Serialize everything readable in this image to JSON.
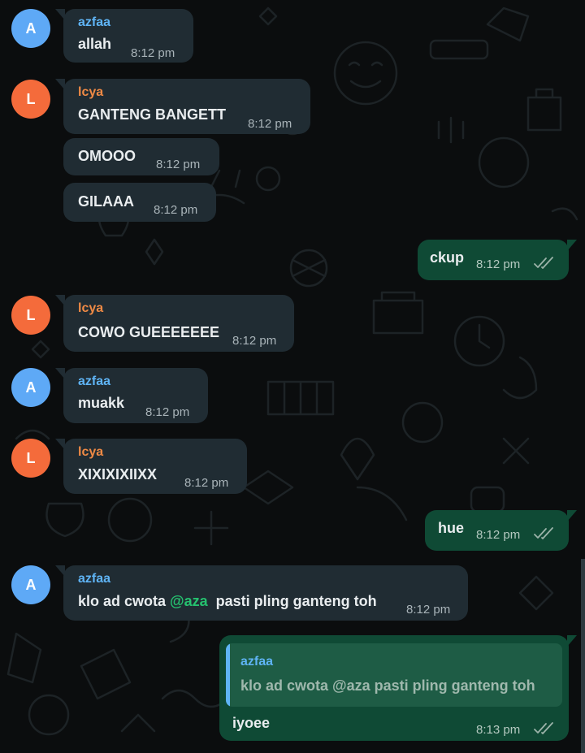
{
  "messages": [
    {
      "sender": "azfaa",
      "initial": "A",
      "text": "allah",
      "time": "8:12 pm"
    },
    {
      "sender": "lcya",
      "initial": "L",
      "text": "GANTENG BANGETT",
      "time": "8:12 pm"
    },
    {
      "text": "OMOOO",
      "time": "8:12 pm"
    },
    {
      "text": "GILAAA",
      "time": "8:12 pm"
    },
    {
      "text": "ckup",
      "time": "8:12 pm",
      "status": "read"
    },
    {
      "sender": "lcya",
      "initial": "L",
      "text": "COWO GUEEEEEEE",
      "time": "8:12 pm"
    },
    {
      "sender": "azfaa",
      "initial": "A",
      "text": "muakk",
      "time": "8:12 pm"
    },
    {
      "sender": "lcya",
      "initial": "L",
      "text": "XIXIXIXIIXX",
      "time": "8:12 pm"
    },
    {
      "text": "hue",
      "time": "8:12 pm",
      "status": "read"
    },
    {
      "sender": "azfaa",
      "initial": "A",
      "text_before": "klo ad cwota",
      "mention": "@aza",
      "text_after": "pasti pling ganteng toh",
      "time": "8:12 pm"
    },
    {
      "quote_sender": "azfaa",
      "quote_text": "klo ad cwota @aza  pasti pling ganteng toh",
      "text": "iyoee",
      "time": "8:13 pm",
      "status": "read"
    }
  ],
  "colors": {
    "background": "#0b0d0e",
    "incoming_bubble": "#202c33",
    "outgoing_bubble": "#0f4a35",
    "azfaa_name": "#5fb4f5",
    "lcya_name": "#f08a45",
    "mention": "#25c16f",
    "avatar_a": "#5ea9f6",
    "avatar_l": "#f46b3b"
  }
}
